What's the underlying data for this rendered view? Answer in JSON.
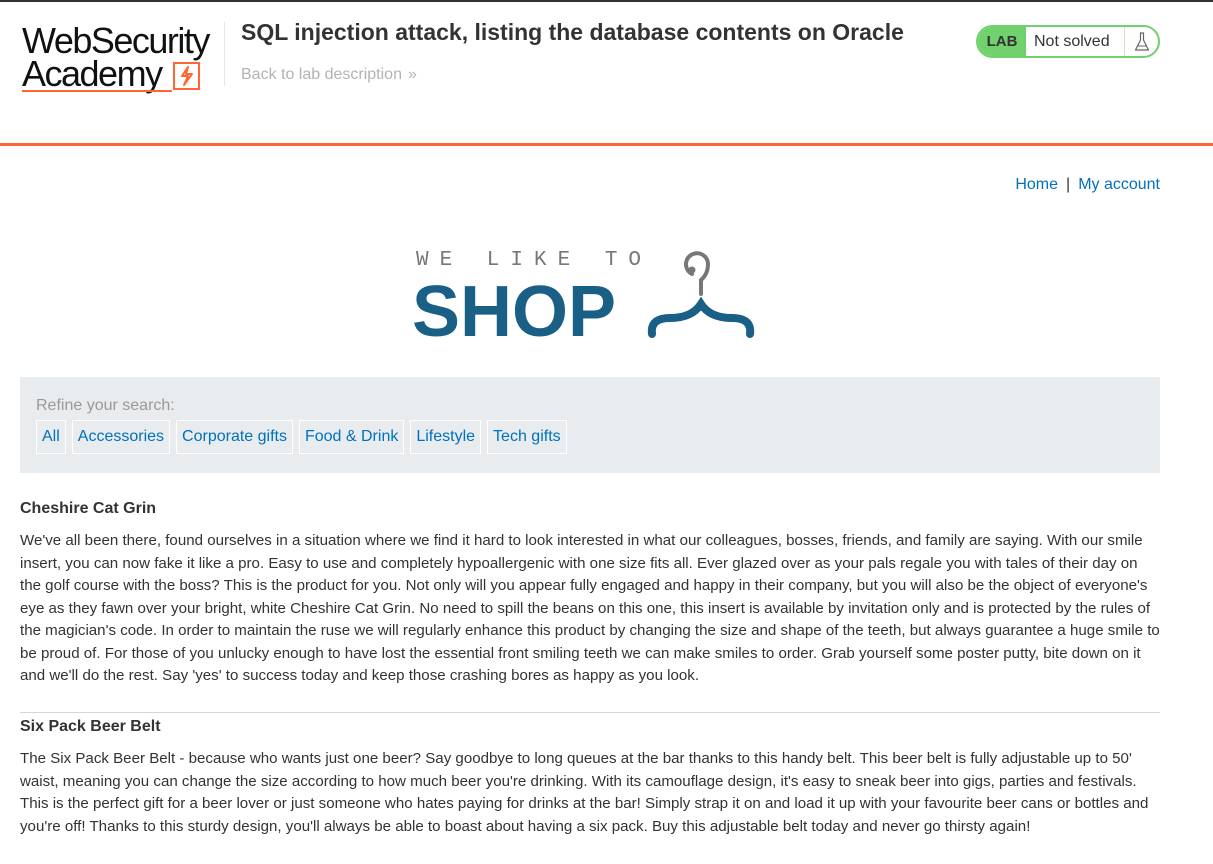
{
  "academy": {
    "logo_line1": "WebSecurity",
    "logo_line2": "Academy",
    "lab_title": "SQL injection attack, listing the database contents on Oracle",
    "back_link": "Back to lab description",
    "back_chevron": "»",
    "status_label": "LAB",
    "status_text": "Not solved",
    "status_icon": "flask-icon",
    "accent_color": "#ff6633",
    "status_color": "#70d16d"
  },
  "nav": {
    "home": "Home",
    "separator": "|",
    "account": "My account"
  },
  "shop_logo": {
    "tagline": "WE LIKE TO",
    "word": "SHOP",
    "icon": "hanger-icon",
    "color": "#1a5f85"
  },
  "filter": {
    "label": "Refine your search:",
    "categories": [
      "All",
      "Accessories",
      "Corporate gifts",
      "Food & Drink",
      "Lifestyle",
      "Tech gifts"
    ]
  },
  "products": [
    {
      "name": "Cheshire Cat Grin",
      "description": "We've all been there, found ourselves in a situation where we find it hard to look interested in what our colleagues, bosses, friends, and family are saying. With our smile insert, you can now fake it like a pro. Easy to use and completely hypoallergenic with one size fits all. Ever glazed over as your pals regale you with tales of their day on the golf course with the boss? This is the product for you. Not only will you appear fully engaged and happy in their company, but you will also be the object of everyone's eye as they fawn over your bright, white Cheshire Cat Grin. No need to spill the beans on this one, this insert is available by invitation only and is protected by the rules of the magician's code. In order to maintain the ruse we will regularly enhance this product by changing the size and shape of the teeth, but always guarantee a huge smile to be proud of. For those of you unlucky enough to have lost the essential front smiling teeth we can make smiles to order. Grab yourself some poster putty, bite down on it and we'll do the rest. Say 'yes' to success today and keep those crashing bores as happy as you look."
    },
    {
      "name": "Six Pack Beer Belt",
      "description": "The Six Pack Beer Belt - because who wants just one beer? Say goodbye to long queues at the bar thanks to this handy belt. This beer belt is fully adjustable up to 50' waist, meaning you can change the size according to how much beer you're drinking. With its camouflage design, it's easy to sneak beer into gigs, parties and festivals. This is the perfect gift for a beer lover or just someone who hates paying for drinks at the bar! Simply strap it on and load it up with your favourite beer cans or bottles and you're off! Thanks to this sturdy design, you'll always be able to boast about having a six pack. Buy this adjustable belt today and never go thirsty again!"
    }
  ]
}
